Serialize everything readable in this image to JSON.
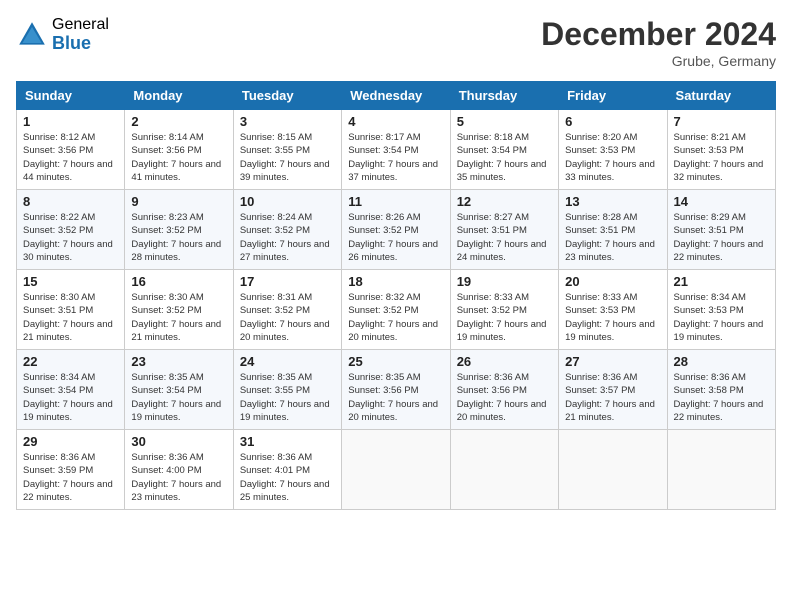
{
  "header": {
    "logo_general": "General",
    "logo_blue": "Blue",
    "month_title": "December 2024",
    "location": "Grube, Germany"
  },
  "days_of_week": [
    "Sunday",
    "Monday",
    "Tuesday",
    "Wednesday",
    "Thursday",
    "Friday",
    "Saturday"
  ],
  "weeks": [
    [
      {
        "day": "1",
        "sunrise": "8:12 AM",
        "sunset": "3:56 PM",
        "daylight": "7 hours and 44 minutes."
      },
      {
        "day": "2",
        "sunrise": "8:14 AM",
        "sunset": "3:56 PM",
        "daylight": "7 hours and 41 minutes."
      },
      {
        "day": "3",
        "sunrise": "8:15 AM",
        "sunset": "3:55 PM",
        "daylight": "7 hours and 39 minutes."
      },
      {
        "day": "4",
        "sunrise": "8:17 AM",
        "sunset": "3:54 PM",
        "daylight": "7 hours and 37 minutes."
      },
      {
        "day": "5",
        "sunrise": "8:18 AM",
        "sunset": "3:54 PM",
        "daylight": "7 hours and 35 minutes."
      },
      {
        "day": "6",
        "sunrise": "8:20 AM",
        "sunset": "3:53 PM",
        "daylight": "7 hours and 33 minutes."
      },
      {
        "day": "7",
        "sunrise": "8:21 AM",
        "sunset": "3:53 PM",
        "daylight": "7 hours and 32 minutes."
      }
    ],
    [
      {
        "day": "8",
        "sunrise": "8:22 AM",
        "sunset": "3:52 PM",
        "daylight": "7 hours and 30 minutes."
      },
      {
        "day": "9",
        "sunrise": "8:23 AM",
        "sunset": "3:52 PM",
        "daylight": "7 hours and 28 minutes."
      },
      {
        "day": "10",
        "sunrise": "8:24 AM",
        "sunset": "3:52 PM",
        "daylight": "7 hours and 27 minutes."
      },
      {
        "day": "11",
        "sunrise": "8:26 AM",
        "sunset": "3:52 PM",
        "daylight": "7 hours and 26 minutes."
      },
      {
        "day": "12",
        "sunrise": "8:27 AM",
        "sunset": "3:51 PM",
        "daylight": "7 hours and 24 minutes."
      },
      {
        "day": "13",
        "sunrise": "8:28 AM",
        "sunset": "3:51 PM",
        "daylight": "7 hours and 23 minutes."
      },
      {
        "day": "14",
        "sunrise": "8:29 AM",
        "sunset": "3:51 PM",
        "daylight": "7 hours and 22 minutes."
      }
    ],
    [
      {
        "day": "15",
        "sunrise": "8:30 AM",
        "sunset": "3:51 PM",
        "daylight": "7 hours and 21 minutes."
      },
      {
        "day": "16",
        "sunrise": "8:30 AM",
        "sunset": "3:52 PM",
        "daylight": "7 hours and 21 minutes."
      },
      {
        "day": "17",
        "sunrise": "8:31 AM",
        "sunset": "3:52 PM",
        "daylight": "7 hours and 20 minutes."
      },
      {
        "day": "18",
        "sunrise": "8:32 AM",
        "sunset": "3:52 PM",
        "daylight": "7 hours and 20 minutes."
      },
      {
        "day": "19",
        "sunrise": "8:33 AM",
        "sunset": "3:52 PM",
        "daylight": "7 hours and 19 minutes."
      },
      {
        "day": "20",
        "sunrise": "8:33 AM",
        "sunset": "3:53 PM",
        "daylight": "7 hours and 19 minutes."
      },
      {
        "day": "21",
        "sunrise": "8:34 AM",
        "sunset": "3:53 PM",
        "daylight": "7 hours and 19 minutes."
      }
    ],
    [
      {
        "day": "22",
        "sunrise": "8:34 AM",
        "sunset": "3:54 PM",
        "daylight": "7 hours and 19 minutes."
      },
      {
        "day": "23",
        "sunrise": "8:35 AM",
        "sunset": "3:54 PM",
        "daylight": "7 hours and 19 minutes."
      },
      {
        "day": "24",
        "sunrise": "8:35 AM",
        "sunset": "3:55 PM",
        "daylight": "7 hours and 19 minutes."
      },
      {
        "day": "25",
        "sunrise": "8:35 AM",
        "sunset": "3:56 PM",
        "daylight": "7 hours and 20 minutes."
      },
      {
        "day": "26",
        "sunrise": "8:36 AM",
        "sunset": "3:56 PM",
        "daylight": "7 hours and 20 minutes."
      },
      {
        "day": "27",
        "sunrise": "8:36 AM",
        "sunset": "3:57 PM",
        "daylight": "7 hours and 21 minutes."
      },
      {
        "day": "28",
        "sunrise": "8:36 AM",
        "sunset": "3:58 PM",
        "daylight": "7 hours and 22 minutes."
      }
    ],
    [
      {
        "day": "29",
        "sunrise": "8:36 AM",
        "sunset": "3:59 PM",
        "daylight": "7 hours and 22 minutes."
      },
      {
        "day": "30",
        "sunrise": "8:36 AM",
        "sunset": "4:00 PM",
        "daylight": "7 hours and 23 minutes."
      },
      {
        "day": "31",
        "sunrise": "8:36 AM",
        "sunset": "4:01 PM",
        "daylight": "7 hours and 25 minutes."
      },
      null,
      null,
      null,
      null
    ]
  ]
}
